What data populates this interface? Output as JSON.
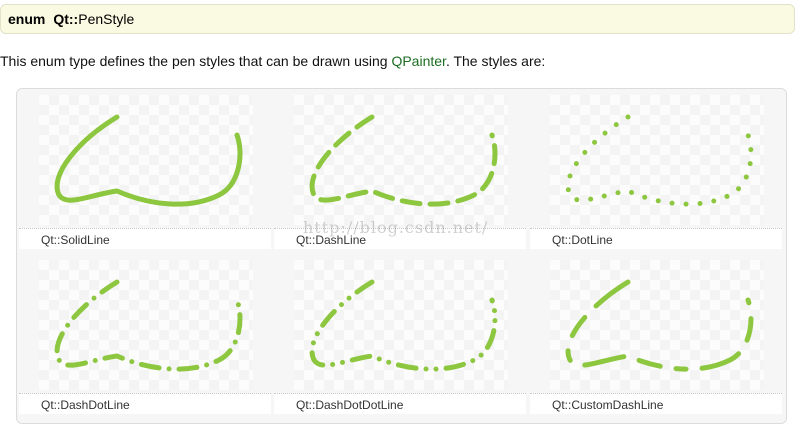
{
  "header": {
    "keyword": "enum",
    "namespace": "Qt::",
    "name": "PenStyle"
  },
  "description": {
    "before": "This enum type defines the pen styles that can be drawn using ",
    "link": "QPainter",
    "after": ". The styles are:"
  },
  "stroke_color": "#8dc63f",
  "styles": [
    {
      "caption": "Qt::SolidLine",
      "dash": ""
    },
    {
      "caption": "Qt::DashLine",
      "dash": "18 10"
    },
    {
      "caption": "Qt::DotLine",
      "dash": "0 14"
    },
    {
      "caption": "Qt::DashDotLine",
      "dash": "18 10 0 10"
    },
    {
      "caption": "Qt::DashDotDotLine",
      "dash": "18 10 0 10 0 10"
    },
    {
      "caption": "Qt::CustomDashLine",
      "dash": "40 16 22 16 10 16"
    }
  ],
  "watermark": "http://blog.csdn.net/"
}
